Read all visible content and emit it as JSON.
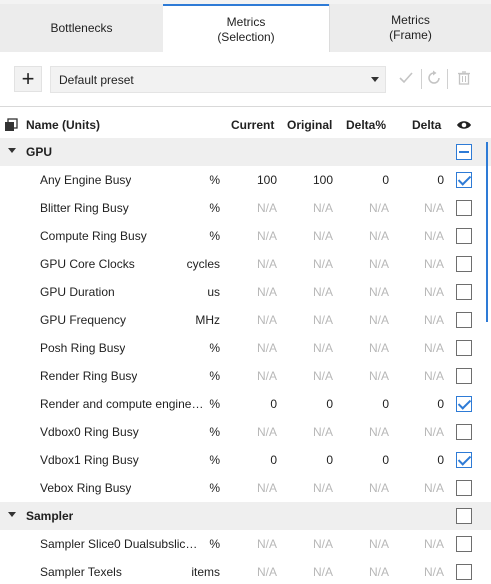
{
  "tabs": [
    {
      "label": "Bottlenecks"
    },
    {
      "label": "Metrics\n(Selection)"
    },
    {
      "label": "Metrics\n(Frame)"
    }
  ],
  "toolbar": {
    "add_label": "+",
    "preset_value": "Default preset",
    "icons": [
      "checkmark-icon",
      "reset-icon",
      "trash-icon"
    ]
  },
  "header": {
    "name": "Name (Units)",
    "current": "Current",
    "original": "Original",
    "delta_pct": "Delta%",
    "delta": "Delta",
    "visibility_icon": "eye-icon"
  },
  "groups": [
    {
      "name": "GPU",
      "state": "indeterminate",
      "rows": [
        {
          "name": "Any Engine Busy",
          "unit": "%",
          "current": "100",
          "original": "100",
          "delta_pct": "0",
          "delta": "0",
          "checked": true
        },
        {
          "name": "Blitter Ring Busy",
          "unit": "%",
          "current": "N/A",
          "original": "N/A",
          "delta_pct": "N/A",
          "delta": "N/A",
          "checked": false
        },
        {
          "name": "Compute Ring Busy",
          "unit": "%",
          "current": "N/A",
          "original": "N/A",
          "delta_pct": "N/A",
          "delta": "N/A",
          "checked": false
        },
        {
          "name": "GPU Core Clocks",
          "unit": "cycles",
          "current": "N/A",
          "original": "N/A",
          "delta_pct": "N/A",
          "delta": "N/A",
          "checked": false
        },
        {
          "name": "GPU Duration",
          "unit": "us",
          "current": "N/A",
          "original": "N/A",
          "delta_pct": "N/A",
          "delta": "N/A",
          "checked": false
        },
        {
          "name": "GPU Frequency",
          "unit": "MHz",
          "current": "N/A",
          "original": "N/A",
          "delta_pct": "N/A",
          "delta": "N/A",
          "checked": false
        },
        {
          "name": "Posh Ring Busy",
          "unit": "%",
          "current": "N/A",
          "original": "N/A",
          "delta_pct": "N/A",
          "delta": "N/A",
          "checked": false
        },
        {
          "name": "Render Ring Busy",
          "unit": "%",
          "current": "N/A",
          "original": "N/A",
          "delta_pct": "N/A",
          "delta": "N/A",
          "checked": false
        },
        {
          "name": "Render and compute engines...",
          "unit": "%",
          "current": "0",
          "original": "0",
          "delta_pct": "0",
          "delta": "0",
          "checked": true
        },
        {
          "name": "Vdbox0 Ring Busy",
          "unit": "%",
          "current": "N/A",
          "original": "N/A",
          "delta_pct": "N/A",
          "delta": "N/A",
          "checked": false
        },
        {
          "name": "Vdbox1 Ring Busy",
          "unit": "%",
          "current": "0",
          "original": "0",
          "delta_pct": "0",
          "delta": "0",
          "checked": true
        },
        {
          "name": "Vebox Ring Busy",
          "unit": "%",
          "current": "N/A",
          "original": "N/A",
          "delta_pct": "N/A",
          "delta": "N/A",
          "checked": false
        }
      ]
    },
    {
      "name": "Sampler",
      "state": "unchecked",
      "rows": [
        {
          "name": "Sampler Slice0 Dualsubslice0 ...",
          "unit": "%",
          "current": "N/A",
          "original": "N/A",
          "delta_pct": "N/A",
          "delta": "N/A",
          "checked": false
        },
        {
          "name": "Sampler Texels",
          "unit": "items",
          "current": "N/A",
          "original": "N/A",
          "delta_pct": "N/A",
          "delta": "N/A",
          "checked": false
        }
      ]
    }
  ],
  "colors": {
    "accent": "#2e7bd6",
    "na_text": "#b8b8b8",
    "group_bg": "#efefef"
  }
}
